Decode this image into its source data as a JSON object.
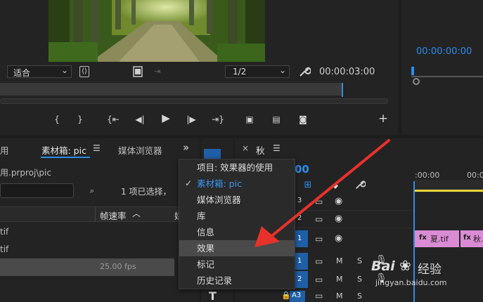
{
  "source_monitor": {
    "fit_label": "适合",
    "resolution": "1/2",
    "timecode": "00:00:03:00",
    "icons": [
      "brackets-icon",
      "filmstrip-icon",
      "expand-icon",
      "chevron-down-icon",
      "wrench-icon"
    ]
  },
  "program_monitor": {
    "timecode": "00:00:00:00"
  },
  "transport": {
    "mark_in": "{",
    "mark_out": "}",
    "add_label": "+"
  },
  "project_panel": {
    "tab_cut": "用",
    "tab_bin": "素材箱: pic",
    "tab_bin_menu": "☰",
    "tab_media_browser": "媒体浏览器",
    "tab_overflow": "»",
    "path": "用.prproj\\pic",
    "selection_status": "1 项已选择，",
    "column_framerate": "帧速率",
    "column_next": "媒",
    "rows": [
      {
        "name": "tif",
        "fps": ""
      },
      {
        "name": "tif",
        "fps": ""
      },
      {
        "name": "",
        "fps": "25.00 fps"
      }
    ]
  },
  "timeline": {
    "close": "×",
    "tab_name": "秋",
    "tab_menu": "☰",
    "timecode_partial": "00",
    "ruler_label": ":00:00",
    "ruler_label_2": "00:0",
    "track_a3": "A3",
    "track_btns": [
      "M",
      "S"
    ],
    "track_row_numbers": [
      "3",
      "2",
      "1",
      "1",
      "2"
    ],
    "clip_label_1": "fx",
    "clip_label_2": "夏.tif",
    "clip_label_3": "fx",
    "clip_label_4": "秋.t",
    "tool_type": "T"
  },
  "panel_menu": {
    "items": [
      {
        "label": "项目: 效果器的使用",
        "checked": false,
        "highlighted": false
      },
      {
        "label": "素材箱: pic",
        "checked": true,
        "highlighted": false
      },
      {
        "label": "媒体浏览器",
        "checked": false,
        "highlighted": false
      },
      {
        "label": "库",
        "checked": false,
        "highlighted": false
      },
      {
        "label": "信息",
        "checked": false,
        "highlighted": false
      },
      {
        "label": "效果",
        "checked": false,
        "highlighted": true
      },
      {
        "label": "标记",
        "checked": false,
        "highlighted": false
      },
      {
        "label": "历史记录",
        "checked": false,
        "highlighted": false
      }
    ],
    "check_glyph": "✓"
  },
  "watermark": {
    "brand": "Bai",
    "brand_cn": "经验",
    "url": "jingyan.baidu.com"
  },
  "colors": {
    "accent_blue": "#2d8ceb",
    "clip_pink": "#d98cd3",
    "arrow_red": "#e8312b",
    "track_blue": "#1f5fa8"
  }
}
